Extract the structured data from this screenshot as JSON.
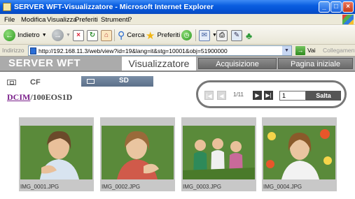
{
  "window": {
    "title": "SERVER WFT-Visualizzatore - Microsoft Internet Explorer",
    "buttons": {
      "minimize": "_",
      "maximize": "□",
      "close": "×"
    }
  },
  "menubar": [
    "File",
    "Modifica",
    "Visualizza",
    "Preferiti",
    "Strumenti",
    "?"
  ],
  "toolbar": {
    "back_label": "Indietro",
    "search_label": "Cerca",
    "favorites_label": "Preferiti"
  },
  "addressbar": {
    "label": "Indirizzo",
    "url": "http://192.168.11.3/web/view?id=19&lang=it&stg=10001&obj=51900000",
    "go_label": "Vai",
    "links_label": "Collegamenti"
  },
  "page": {
    "logo": "SERVER WFT",
    "tabs": {
      "viewer": "Visualizzatore",
      "capture": "Acquisizione",
      "home": "Pagina iniziale"
    },
    "cards": {
      "cf": "CF",
      "sd": "SD"
    },
    "path": {
      "root": "DCIM",
      "folder": "/100EOS1D"
    },
    "pager": {
      "count": "1/11",
      "jump_value": "1",
      "jump_label": "Salta"
    },
    "thumbnails": [
      {
        "caption": "IMG_0001.JPG"
      },
      {
        "caption": "IMG_0002.JPG"
      },
      {
        "caption": "IMG_0003.JPG"
      },
      {
        "caption": "IMG_0004.JPG"
      }
    ]
  },
  "colors": {
    "titlebar": "#0553d6",
    "header": "#ababab",
    "sd_tab": "#5c708a",
    "path_link": "#7a1f8a"
  }
}
